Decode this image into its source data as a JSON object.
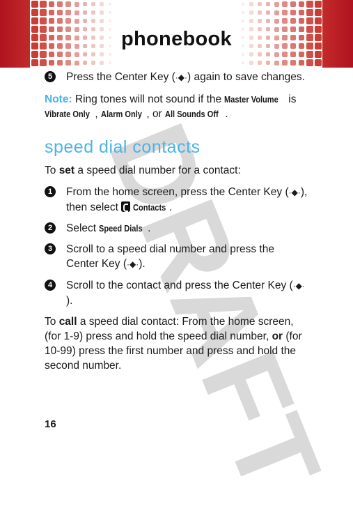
{
  "header": {
    "title": "phonebook",
    "brand_color": "#b0121f"
  },
  "watermark": {
    "text": "DRAFT",
    "color": "#d9d9d9"
  },
  "step5": {
    "num": "5",
    "pre": "Press the Center Key (",
    "key_icon": "center-key",
    "key": "·◆·",
    "post": ") again to save changes."
  },
  "note": {
    "label": "Note:",
    "t1": " Ring tones will not sound if the ",
    "b1": "Master Volume",
    "t2": " is ",
    "b2": "Vibrate Only",
    "t3": ", ",
    "b3": "Alarm Only",
    "t4": ", or ",
    "b4": "All Sounds Off",
    "t5": "."
  },
  "section": {
    "heading": "speed dial contacts",
    "accent_color": "#4bb4e6"
  },
  "set_intro": {
    "pre": "To ",
    "bold": "set",
    "post": " a speed dial number for a contact:"
  },
  "steps": [
    {
      "num": "1",
      "t1": "From the home screen, press the Center Key (",
      "key": "·◆·",
      "t2": "), then select ",
      "ui": "Contacts",
      "t3": "."
    },
    {
      "num": "2",
      "t1": "Select ",
      "ui": "Speed Dials",
      "t3": "."
    },
    {
      "num": "3",
      "t1": "Scroll to a speed dial number and press the Center Key (",
      "key": "·◆·",
      "t2": ")."
    },
    {
      "num": "4",
      "t1": "Scroll to the contact and press the Center Key (",
      "key": "·◆·",
      "t2": ")."
    }
  ],
  "call_para": {
    "pre": "To ",
    "bold1": "call",
    "mid": " a speed dial contact: From the home screen, (for 1-9) press and hold the speed dial number, ",
    "bold2": "or",
    "post": " (for 10-99) press the first number and press and hold the second number."
  },
  "page_number": "16"
}
